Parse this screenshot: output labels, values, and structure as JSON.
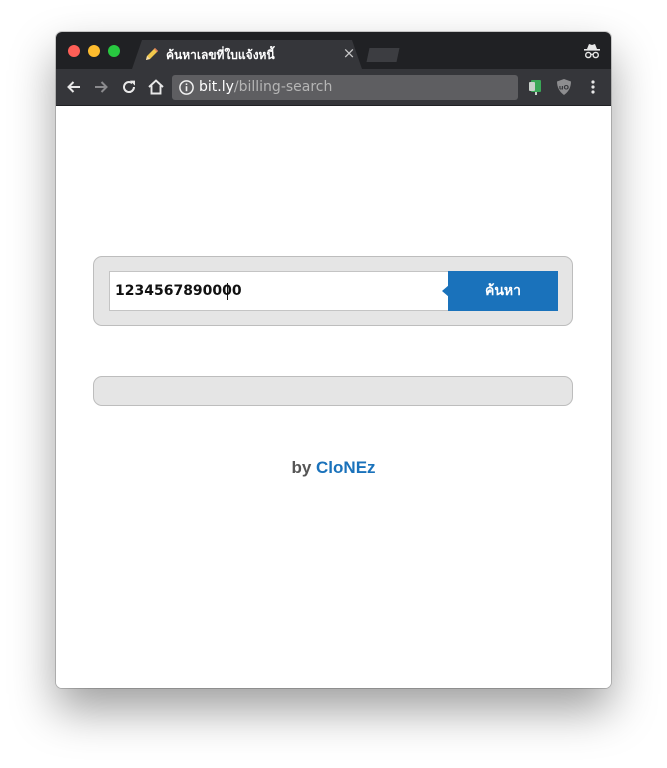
{
  "browser": {
    "tab": {
      "title": "ค้นหาเลขที่ใบแจ้งหนี้",
      "close_glyph": "×",
      "favicon": "pencil-icon"
    },
    "incognito_icon": "incognito-icon",
    "nav": {
      "back_icon": "back-arrow-icon",
      "forward_icon": "forward-arrow-icon",
      "reload_icon": "reload-icon",
      "home_icon": "home-icon"
    },
    "address_bar": {
      "security_icon": "info-icon",
      "url_domain": "bit.ly",
      "url_path": "/billing-search"
    },
    "extensions": [
      "extension-icon",
      "ublock-icon",
      "menu-dots-icon"
    ]
  },
  "page": {
    "search": {
      "input_value": "1234567890000",
      "button_label": "ค้นหา"
    },
    "result": {
      "text": ""
    },
    "credit": {
      "by": "by",
      "author": "CloNEz"
    }
  },
  "colors": {
    "titlebar": "#202124",
    "toolbar": "#35363a",
    "accent": "#1a72bb",
    "panel": "#e5e5e5"
  }
}
